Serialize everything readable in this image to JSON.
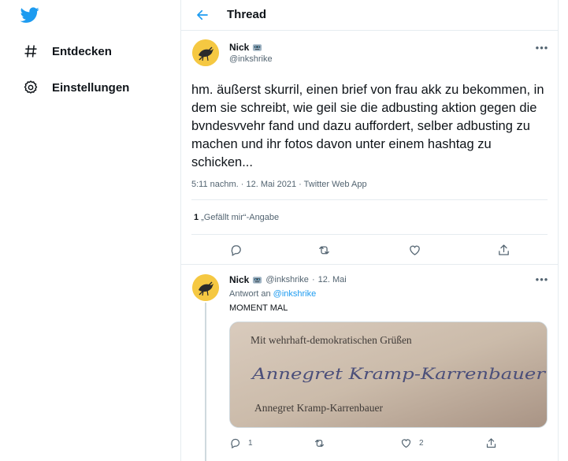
{
  "sidebar": {
    "logo_icon": "twitter-bird-icon",
    "items": [
      {
        "label": "Entdecken",
        "icon": "hashtag-icon"
      },
      {
        "label": "Einstellungen",
        "icon": "gear-icon"
      }
    ]
  },
  "header": {
    "title": "Thread",
    "back_icon": "arrow-left-icon"
  },
  "tweet": {
    "author_name": "Nick",
    "author_handle": "@inkshrike",
    "text": "hm. äußerst skurril, einen brief von frau akk zu bekommen, in dem sie schreibt, wie geil sie die adbusting aktion gegen die bvndesvvehr fand und dazu auffordert, selber adbusting zu machen und ihr fotos davon unter einem hashtag zu schicken...",
    "meta": "5:11 nachm. · 12. Mai 2021 · Twitter Web App",
    "likes_count": "1",
    "likes_label": "„Gefällt mir“-Angabe"
  },
  "reply": {
    "author_name": "Nick",
    "author_handle": "@inkshrike",
    "separator": "·",
    "date": "12. Mai",
    "reply_to_prefix": "Antwort an",
    "reply_to_handle": "@inkshrike",
    "text": "MOMENT MAL",
    "image": {
      "line1": "Mit wehrhaft-demokratischen Grüßen",
      "signature": "Annegret Kramp-Karrenbauer",
      "line2": "Annegret Kramp-Karrenbauer"
    },
    "reply_count": "1",
    "retweet_count": "",
    "like_count": "2"
  },
  "colors": {
    "accent": "#1d9bf0",
    "muted": "#536471",
    "divider": "#e6ecf0",
    "avatar_bg": "#f5c842"
  }
}
